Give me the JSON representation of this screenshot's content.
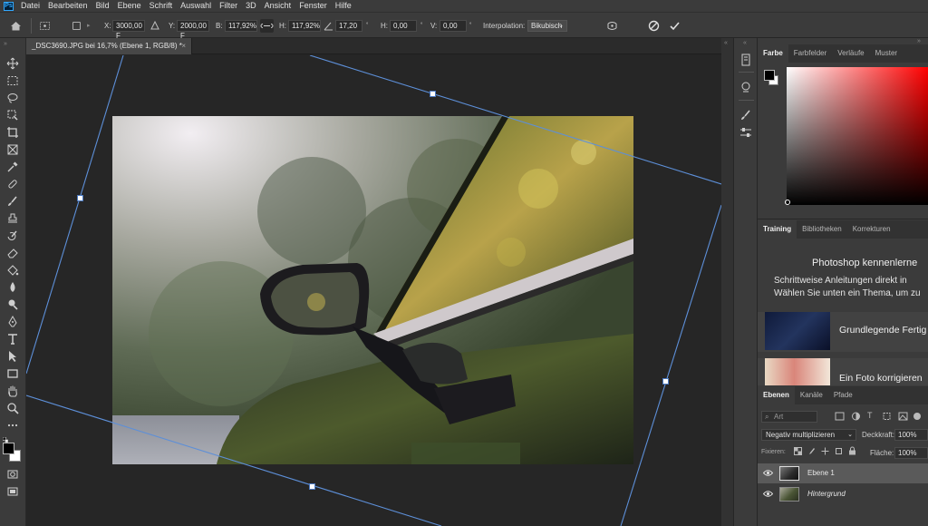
{
  "menu": {
    "app_logo": "Ps",
    "items": [
      "Datei",
      "Bearbeiten",
      "Bild",
      "Ebene",
      "Schrift",
      "Auswahl",
      "Filter",
      "3D",
      "Ansicht",
      "Fenster",
      "Hilfe"
    ]
  },
  "options": {
    "x_label": "X:",
    "x_value": "3000,00 F",
    "y_label": "Y:",
    "y_value": "2000,00 F",
    "b_label": "B:",
    "b_value": "117,92%",
    "h_label": "H:",
    "h_value": "117,92%",
    "angle_value": "17,20",
    "skew_h_label": "H:",
    "skew_h_value": "0,00",
    "skew_v_label": "V:",
    "skew_v_value": "0,00",
    "interp_label": "Interpolation:",
    "interp_value": "Bikubisch"
  },
  "document": {
    "tab_title": "_DSC3690.JPG bei 16,7% (Ebene 1, RGB/8) *",
    "tab_close": "×"
  },
  "panels": {
    "color_tabs": [
      "Farbe",
      "Farbfelder",
      "Verläufe",
      "Muster"
    ],
    "learn_tabs": [
      "Training",
      "Bibliotheken",
      "Korrekturen"
    ],
    "learn_title": "Photoshop kennenlerne",
    "learn_line1": "Schrittweise Anleitungen direkt in",
    "learn_line2": "Wählen Sie unten ein Thema, um zu",
    "learn_cards": [
      "Grundlegende Fertig",
      "Ein Foto korrigieren"
    ],
    "layers_tabs": [
      "Ebenen",
      "Kanäle",
      "Pfade"
    ],
    "filter_placeholder": "Art",
    "blend_mode": "Negativ multiplizieren",
    "opacity_label": "Deckkraft:",
    "opacity_value": "100%",
    "lock_label": "Fixieren:",
    "fill_label": "Fläche:",
    "fill_value": "100%",
    "layers": [
      {
        "name": "Ebene 1"
      },
      {
        "name": "Hintergrund"
      }
    ]
  },
  "colors": {
    "accent": "#31a8ff",
    "selection_line": "#5d8fd8"
  }
}
